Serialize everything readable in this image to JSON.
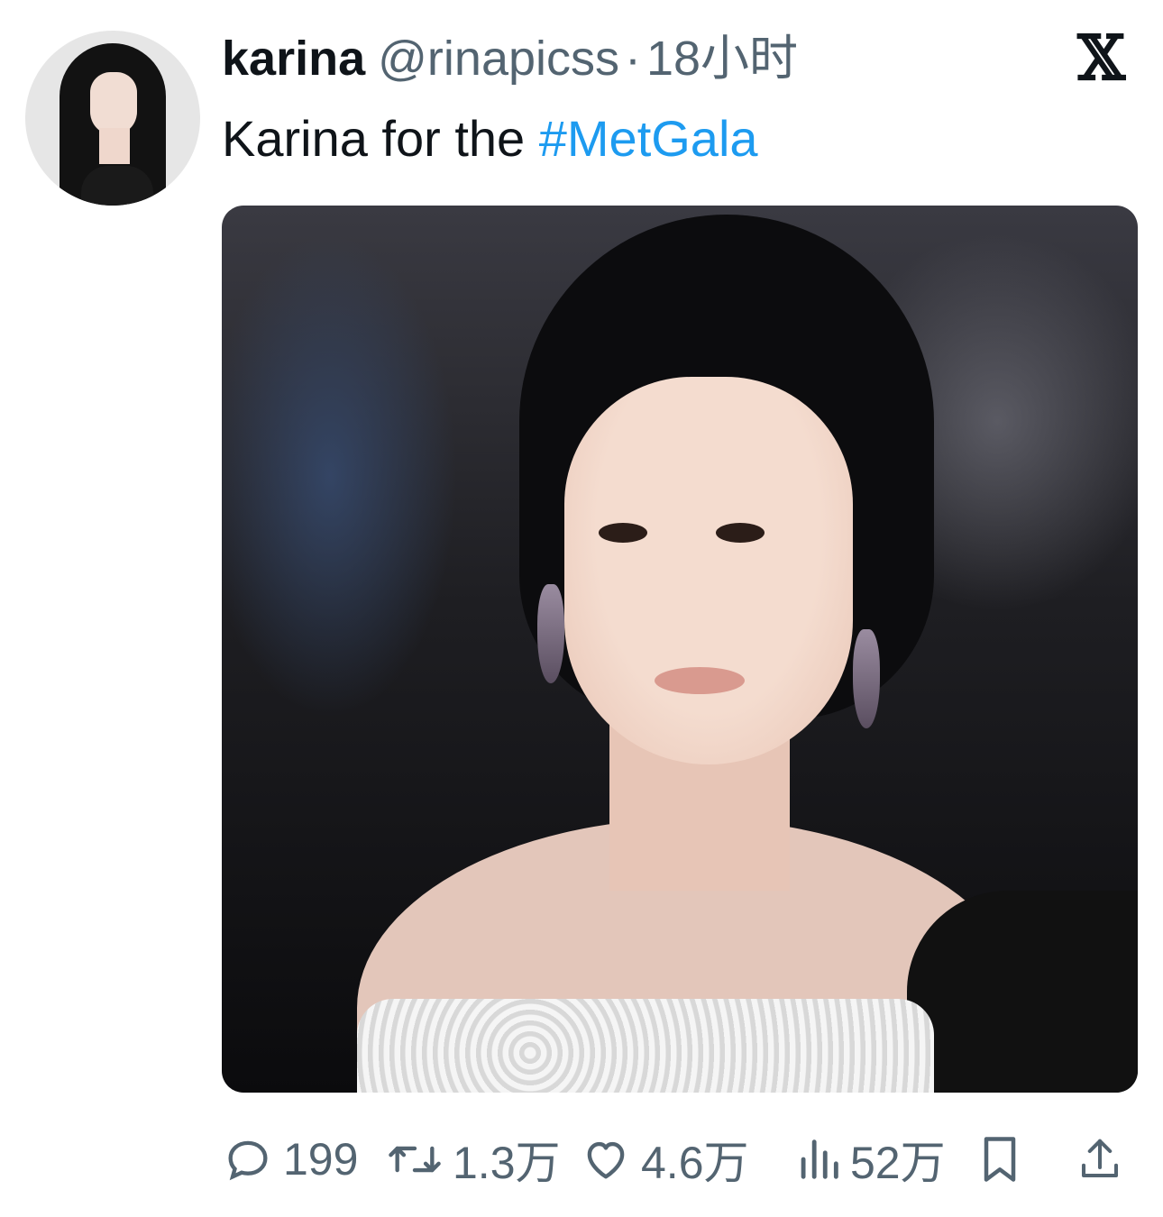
{
  "tweet": {
    "display_name": "karina",
    "handle": "@rinapicss",
    "separator": "·",
    "time": "18小时",
    "text_plain": "Karina for the ",
    "hashtag": "#MetGala",
    "brand_icon": "x-logo",
    "brand_glyph": "𝕏",
    "colors": {
      "hashtag": "#1d9bf0",
      "secondary": "#536471"
    }
  },
  "actions": {
    "replies": {
      "icon": "reply-icon",
      "count": "199"
    },
    "retweets": {
      "icon": "retweet-icon",
      "count": "1.3万"
    },
    "likes": {
      "icon": "heart-icon",
      "count": "4.6万"
    },
    "views": {
      "icon": "views-icon",
      "count": "52万"
    },
    "bookmark": {
      "icon": "bookmark-icon"
    },
    "share": {
      "icon": "share-icon"
    }
  }
}
